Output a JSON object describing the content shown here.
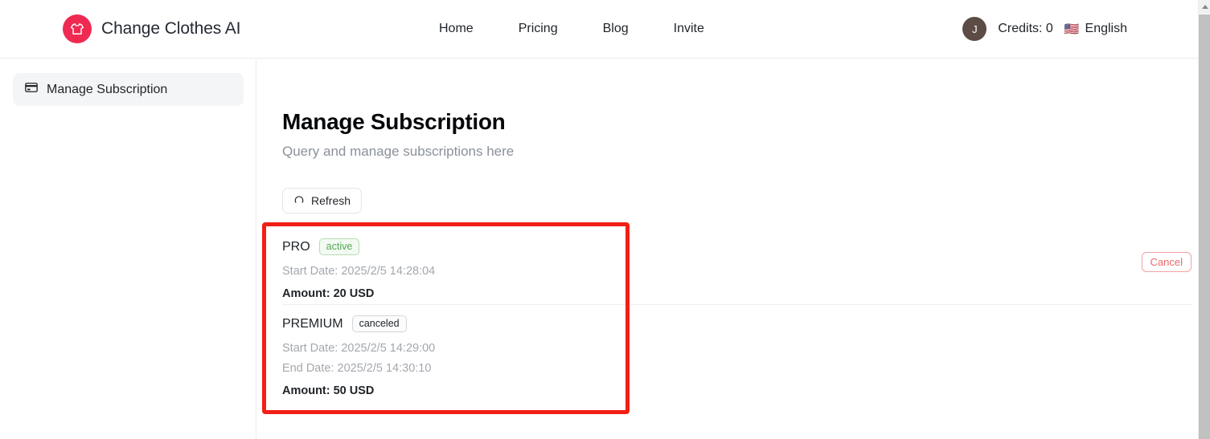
{
  "header": {
    "brand_name": "Change Clothes AI",
    "logo_icon": "tshirt-icon",
    "logo_color": "#ef2a52",
    "nav": [
      {
        "label": "Home"
      },
      {
        "label": "Pricing"
      },
      {
        "label": "Blog"
      },
      {
        "label": "Invite"
      }
    ],
    "avatar_initial": "J",
    "credits_label": "Credits: 0",
    "flag": "🇺🇸",
    "language": "English"
  },
  "sidebar": {
    "items": [
      {
        "label": "Manage Subscription",
        "icon": "credit-card-icon",
        "active": true
      }
    ]
  },
  "main": {
    "title": "Manage Subscription",
    "subtitle": "Query and manage subscriptions here",
    "refresh_label": "Refresh",
    "refresh_icon": "refresh-icon",
    "subscriptions": [
      {
        "plan": "PRO",
        "status": "active",
        "status_style": "active",
        "start_date": "Start Date: 2025/2/5 14:28:04",
        "end_date": "",
        "amount": "Amount: 20 USD",
        "action_label": "Cancel",
        "has_action": true
      },
      {
        "plan": "PREMIUM",
        "status": "canceled",
        "status_style": "canceled",
        "start_date": "Start Date: 2025/2/5 14:29:00",
        "end_date": "End Date: 2025/2/5 14:30:10",
        "amount": "Amount: 50 USD",
        "action_label": "",
        "has_action": false
      }
    ]
  },
  "annotation": {
    "color": "#f21f16"
  },
  "colors": {
    "accent": "#ef2a52",
    "status_active": "#55a855",
    "status_canceled": "#22262b",
    "cancel_action": "#e96a6a",
    "muted_text": "#a3a8ae"
  }
}
